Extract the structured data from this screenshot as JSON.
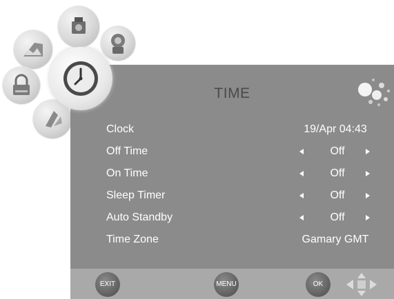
{
  "menu": {
    "title": "TIME",
    "rows": [
      {
        "label": "Clock",
        "value": "19/Apr 04:43"
      },
      {
        "label": "Off Time",
        "value": "Off"
      },
      {
        "label": "On Time",
        "value": "Off"
      },
      {
        "label": "Sleep Timer",
        "value": "Off"
      },
      {
        "label": "Auto Standby",
        "value": "Off"
      },
      {
        "label": "Time Zone",
        "value": "Gamary GMT"
      }
    ]
  },
  "footer": {
    "exit_label": "EXIT",
    "menu_label": "MENU",
    "ok_label": "OK"
  },
  "categories": [
    "camera-icon",
    "picture-icon",
    "sound-icon",
    "lock-icon",
    "options-icon",
    "clock-icon"
  ],
  "colors": {
    "panel": "#8b8b8b",
    "footer": "#a9a9a9",
    "text": "#ffffff",
    "title": "#4a4a4a"
  }
}
